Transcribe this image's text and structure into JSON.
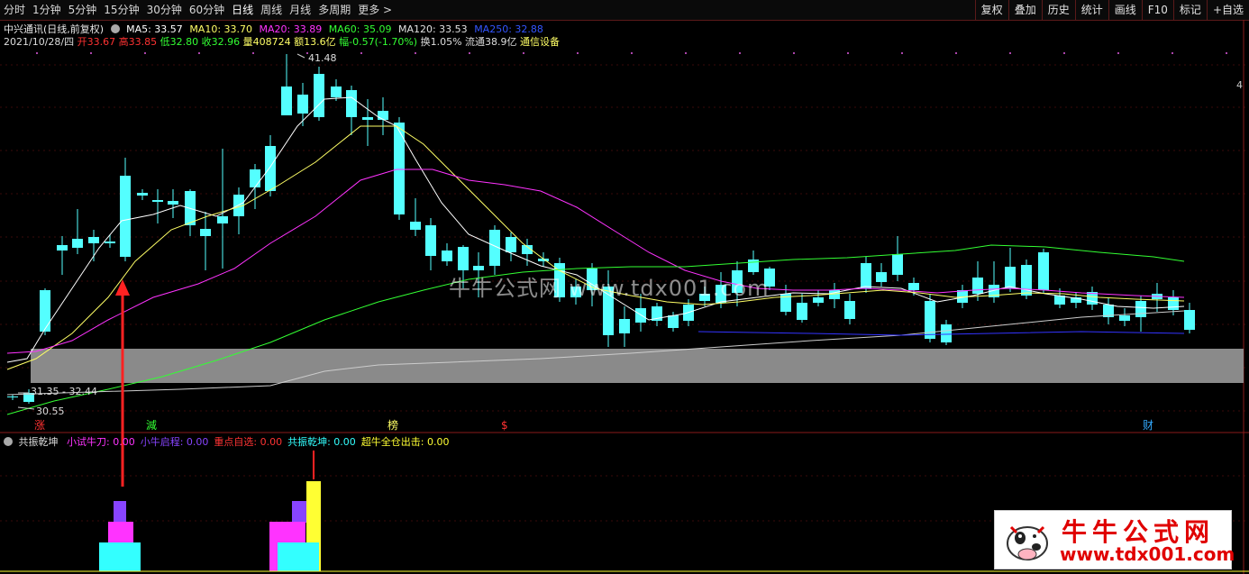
{
  "toolbar": {
    "periods": [
      "分时",
      "1分钟",
      "5分钟",
      "15分钟",
      "30分钟",
      "60分钟",
      "日线",
      "周线",
      "月线",
      "多周期",
      "更多 >"
    ],
    "active_period": "日线",
    "right_buttons": [
      "复权",
      "叠加",
      "历史",
      "统计",
      "画线",
      "F10",
      "标记",
      "+自选"
    ]
  },
  "stock": {
    "title": "中兴通讯(日线,前复权)",
    "ma5": "MA5: 33.57",
    "ma10": "MA10: 33.70",
    "ma20": "MA20: 33.89",
    "ma60": "MA60: 35.09",
    "ma120": "MA120: 33.53",
    "ma250": "MA250: 32.88"
  },
  "quote": {
    "date": "2021/10/28/四",
    "open": "开33.67",
    "high": "高33.85",
    "low": "低32.80",
    "close": "收32.96",
    "volume": "量408724",
    "amount": "额13.6亿",
    "change": "幅-0.57(-1.70%)",
    "turnover": "换1.05%",
    "float": "流通38.9亿",
    "industry": "通信设备"
  },
  "annotations": {
    "high_price": "41.48",
    "box_range": "31.35 - 32.44",
    "low_price": "30.55",
    "right_edge": "4",
    "markers": [
      "涨",
      "減",
      "榜",
      "$",
      "财"
    ]
  },
  "sub_legend": {
    "name": "共振乾坤",
    "items": [
      {
        "label": "小试牛刀: 0.00",
        "color": "#ff33ff"
      },
      {
        "label": "小牛启程: 0.00",
        "color": "#8844ff"
      },
      {
        "label": "重点自选: 0.00",
        "color": "#ff3333"
      },
      {
        "label": "共振乾坤: 0.00",
        "color": "#33ffff"
      },
      {
        "label": "超牛全仓出击: 0.00",
        "color": "#ffff33"
      }
    ]
  },
  "watermark": "牛牛公式网 www.tdx001.com",
  "logo": {
    "title": "牛牛公式网",
    "url": "www.tdx001.com"
  },
  "colors": {
    "up": "#ff3232",
    "down": "#54ffff",
    "ma5": "#ffffff",
    "ma10": "#ffff66",
    "ma20": "#ff33ff",
    "ma60": "#33ff33",
    "ma120": "#cccccc",
    "ma250": "#3333ff"
  }
}
